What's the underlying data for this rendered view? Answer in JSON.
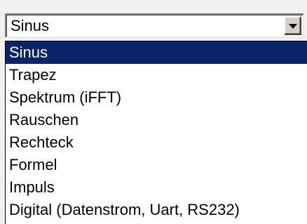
{
  "combo": {
    "value": "Sinus",
    "button_icon": "chevron-down-icon"
  },
  "dropdown": {
    "selected_index": 0,
    "items": [
      "Sinus",
      "Trapez",
      "Spektrum (iFFT)",
      "Rauschen",
      "Rechteck",
      "Formel",
      "Impuls",
      "Digital (Datenstrom, Uart, RS232)"
    ]
  },
  "colors": {
    "selection_bg": "#0a246a",
    "selection_fg": "#ffffff",
    "list_bg": "#ffffff",
    "page_bg": "#f0f0f0"
  }
}
